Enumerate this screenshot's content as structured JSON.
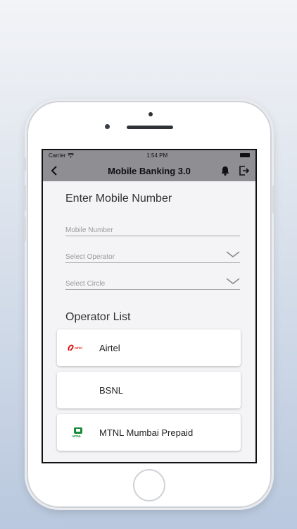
{
  "status": {
    "carrier": "Carrier",
    "time": "1:54 PM"
  },
  "nav": {
    "title": "Mobile Banking 3.0",
    "back_icon": "chevron-left-icon",
    "bell_icon": "bell-icon",
    "logout_icon": "logout-icon"
  },
  "form": {
    "title": "Enter Mobile Number",
    "mobile_placeholder": "Mobile Number",
    "operator_placeholder": "Select Operator",
    "circle_placeholder": "Select Circle"
  },
  "operators": {
    "title": "Operator List",
    "items": [
      {
        "name": "Airtel",
        "logo": "airtel-logo-icon",
        "logo_text": "airtel"
      },
      {
        "name": "BSNL",
        "logo": ""
      },
      {
        "name": "MTNL Mumbai Prepaid",
        "logo": "mtnl-logo-icon",
        "logo_text": "MTNL"
      }
    ]
  },
  "colors": {
    "bar": "#8e8e93",
    "screen_bg": "#f4f4f6",
    "airtel_red": "#e40000",
    "mtnl_green": "#1a8a3a"
  }
}
